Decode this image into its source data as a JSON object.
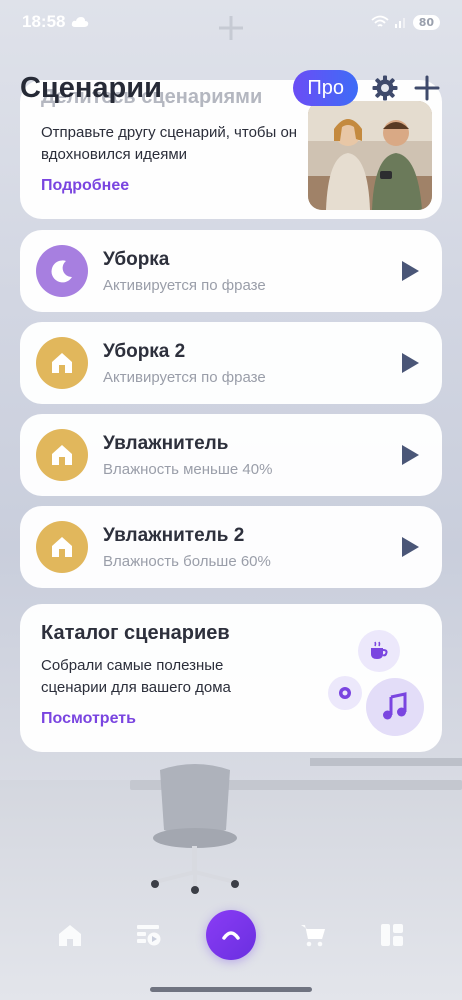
{
  "status_bar": {
    "time": "18:58",
    "battery": "80"
  },
  "header": {
    "title": "Сценарии",
    "pro_label": "Про"
  },
  "share_card": {
    "title": "Делитесь сценариями",
    "text": "Отправьте другу сценарий, чтобы он вдохновился идеями",
    "link": "Подробнее"
  },
  "scenarios": [
    {
      "name": "Уборка",
      "subtitle": "Активируется по фразе",
      "icon": "moon-icon",
      "color": "#a77fe0"
    },
    {
      "name": "Уборка 2",
      "subtitle": "Активируется по фразе",
      "icon": "house-icon",
      "color": "#e1b75c"
    },
    {
      "name": "Увлажнитель",
      "subtitle": "Влажность меньше 40%",
      "icon": "house-icon",
      "color": "#e1b75c"
    },
    {
      "name": "Увлажнитель 2",
      "subtitle": "Влажность больше 60%",
      "icon": "house-icon",
      "color": "#e1b75c"
    }
  ],
  "catalog_card": {
    "title": "Каталог сценариев",
    "text": "Собрали самые полезные сценарии для вашего дома",
    "link": "Посмотреть"
  },
  "bottom_nav": {
    "items": [
      "home-icon",
      "scenarios-icon",
      "alice-icon",
      "cart-icon",
      "devices-icon"
    ]
  },
  "colors": {
    "accent": "#7a45e0",
    "play": "#4a5677",
    "title": "#262a36"
  }
}
